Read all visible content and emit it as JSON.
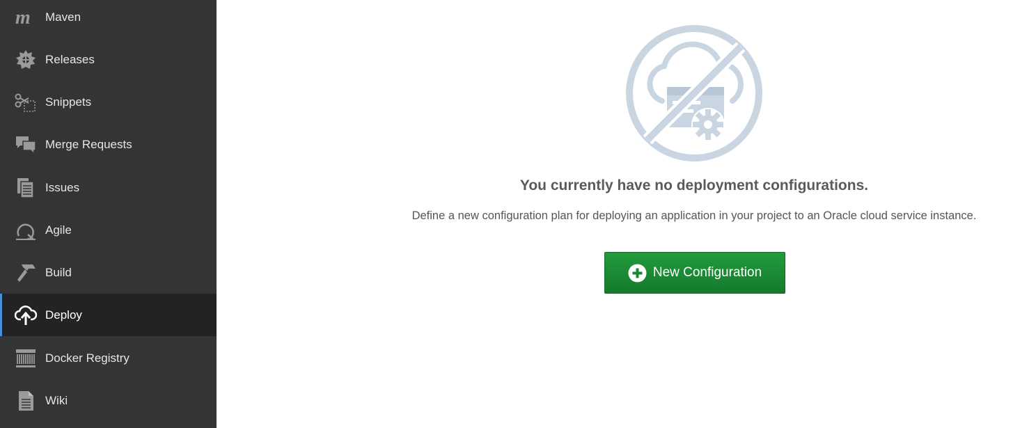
{
  "sidebar": {
    "items": [
      {
        "label": "Maven",
        "icon": "maven-icon",
        "active": false
      },
      {
        "label": "Releases",
        "icon": "releases-icon",
        "active": false
      },
      {
        "label": "Snippets",
        "icon": "snippets-icon",
        "active": false
      },
      {
        "label": "Merge Requests",
        "icon": "merge-requests-icon",
        "active": false
      },
      {
        "label": "Issues",
        "icon": "issues-icon",
        "active": false
      },
      {
        "label": "Agile",
        "icon": "agile-icon",
        "active": false
      },
      {
        "label": "Build",
        "icon": "build-icon",
        "active": false
      },
      {
        "label": "Deploy",
        "icon": "deploy-icon",
        "active": true
      },
      {
        "label": "Docker Registry",
        "icon": "docker-registry-icon",
        "active": false
      },
      {
        "label": "Wiki",
        "icon": "wiki-icon",
        "active": false
      }
    ]
  },
  "main": {
    "empty_title": "You currently have no deployment configurations.",
    "empty_description": "Define a new configuration plan for deploying an application in your project to an Oracle cloud service instance.",
    "new_button_label": "New Configuration",
    "illustration_icon": "no-cloud-deploy-icon"
  },
  "colors": {
    "sidebar_bg": "#333436",
    "sidebar_active_bg": "#232325",
    "active_accent": "#4a90d9",
    "button_green": "#1d8a35",
    "illustration": "#c9d6e2"
  }
}
